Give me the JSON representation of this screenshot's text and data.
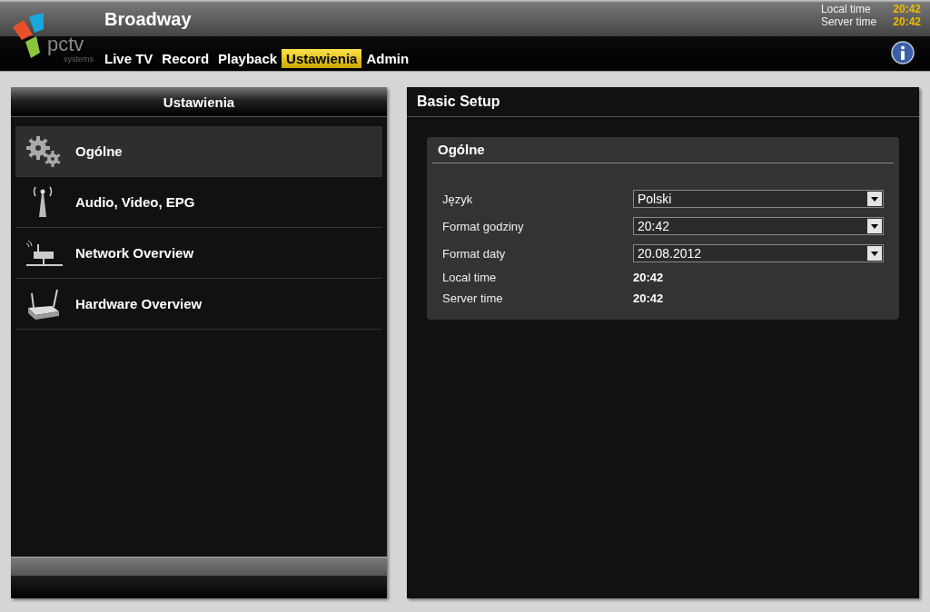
{
  "header": {
    "logo": {
      "wordmark": "pctv",
      "tagline": "systems"
    },
    "title": "Broadway",
    "clock": [
      {
        "label": "Local time",
        "value": "20:42"
      },
      {
        "label": "Server time",
        "value": "20:42"
      }
    ],
    "nav": [
      {
        "label": "Live TV",
        "selected": false
      },
      {
        "label": "Record",
        "selected": false
      },
      {
        "label": "Playback",
        "selected": false
      },
      {
        "label": "Ustawienia",
        "selected": true
      },
      {
        "label": "Admin",
        "selected": false
      }
    ]
  },
  "sidebar": {
    "title": "Ustawienia",
    "items": [
      {
        "label": "Ogólne",
        "kind": "gears",
        "selected": true
      },
      {
        "label": "Audio, Video, EPG",
        "kind": "antenna",
        "selected": false
      },
      {
        "label": "Network Overview",
        "kind": "network",
        "selected": false
      },
      {
        "label": "Hardware Overview",
        "kind": "router",
        "selected": false
      }
    ]
  },
  "main": {
    "title": "Basic Setup",
    "section": {
      "title": "Ogólne",
      "rows": [
        {
          "kind": "select",
          "label": "Język",
          "value": "Polski"
        },
        {
          "kind": "select",
          "label": "Format godziny",
          "value": "20:42"
        },
        {
          "kind": "select",
          "label": "Format daty",
          "value": "20.08.2012"
        },
        {
          "kind": "text",
          "label": "Local time",
          "value": "20:42"
        },
        {
          "kind": "text",
          "label": "Server time",
          "value": "20:42"
        }
      ]
    }
  }
}
